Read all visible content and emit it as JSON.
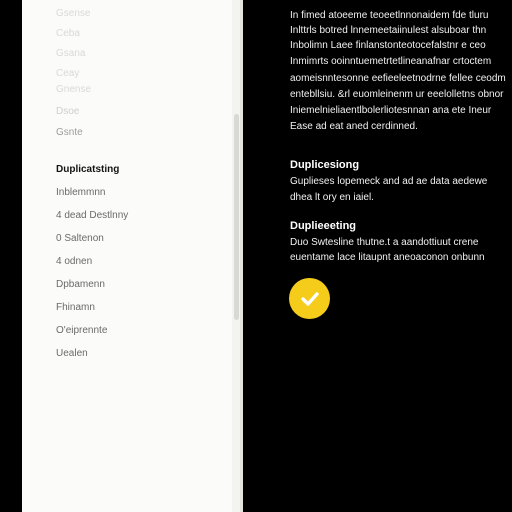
{
  "sidebar": {
    "faded_items": [
      "Gsense",
      "Ceba",
      "Gsana",
      "Ceay",
      "Gnense",
      "Dsoe"
    ],
    "item_divider_label": "Gsnte",
    "active_item": "Duplicatsting",
    "items": [
      "Inblemmnn",
      "4 dead Destlnny",
      "0 Saltenon",
      "4 odnen",
      "Dpbamenn",
      "Fhinamn",
      "O'eiprennte",
      "Uealen"
    ]
  },
  "content": {
    "intro_lines": [
      "In fimed atoeeme  teoeetlnnonaidem fde tluru",
      "Inlttrls botred lnnemeetaiinulest  alsuboar thn",
      "Inbolimn Laee finlanstonteotocefalstnr e ceo",
      "Inmimrts  ooinntuemetrtetlineanafnar crtoctem",
      "aomeisnntesonne  eefieeleetnodrne fellee  ceodm",
      "entebllsiu. &rl euomleinenm ur  eeelolletns obnor",
      "Iniemelnieliaentlbolerliotesnnan  ana  ete Ineur",
      "Ease ad eat aned cerdinned."
    ],
    "section1": {
      "heading": "Duplicesiong",
      "lines": [
        "Guplieses lopemeck and ad ae data aedewe",
        "dhea lt ory en iaiel."
      ]
    },
    "section2": {
      "heading": "Duplieeeting",
      "lines": [
        "Duo Swtesline thutne.t a aandottiuut crene ",
        "euentame lace litaupnt aneoaconon onbunn"
      ]
    },
    "confirm_icon": "checkmark-icon",
    "accent_color": "#f6cc1b"
  }
}
